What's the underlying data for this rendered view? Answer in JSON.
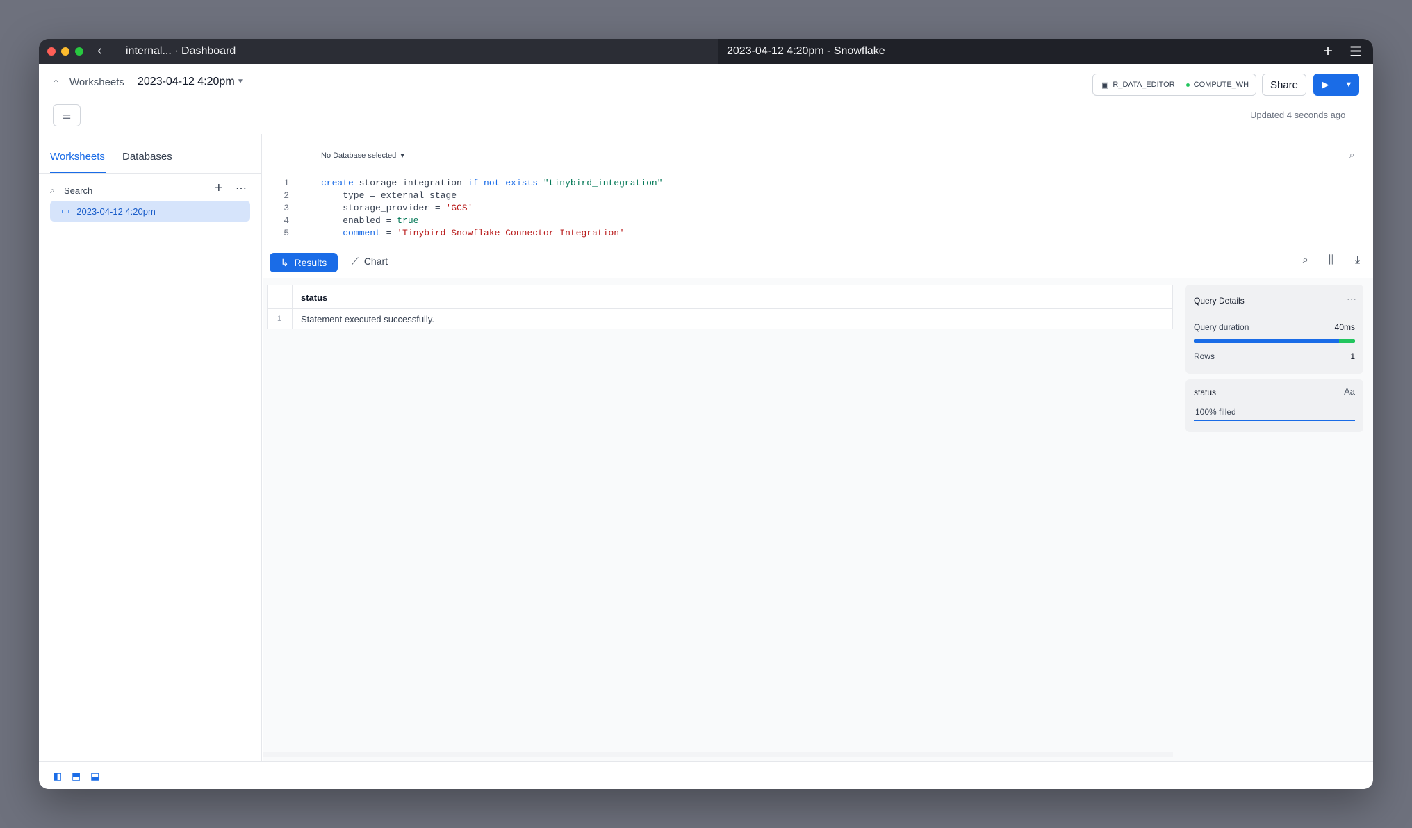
{
  "titlebar": {
    "left_title": "internal... · Dashboard",
    "right_title": "2023-04-12 4:20pm - Snowflake"
  },
  "header": {
    "breadcrumb": "Worksheets",
    "worksheet_title": "2023-04-12 4:20pm",
    "role": "R_DATA_EDITOR",
    "warehouse": "COMPUTE_WH",
    "share_label": "Share",
    "updated": "Updated 4 seconds ago"
  },
  "sidebar": {
    "tabs": [
      {
        "label": "Worksheets",
        "active": true
      },
      {
        "label": "Databases",
        "active": false
      }
    ],
    "search_placeholder": "Search",
    "items": [
      {
        "label": "2023-04-12 4:20pm",
        "selected": true
      }
    ]
  },
  "editor": {
    "database_selector": "No Database selected",
    "lines": [
      {
        "n": "1"
      },
      {
        "n": "2"
      },
      {
        "n": "3"
      },
      {
        "n": "4"
      },
      {
        "n": "5"
      }
    ]
  },
  "results": {
    "tabs": [
      {
        "label": "Results",
        "active": true
      },
      {
        "label": "Chart",
        "active": false
      }
    ],
    "columns": [
      "status"
    ],
    "rows": [
      {
        "n": "1",
        "status": "Statement executed successfully."
      }
    ]
  },
  "query_details": {
    "title": "Query Details",
    "duration_label": "Query duration",
    "duration_value": "40ms",
    "duration_bar_fraction": 0.9,
    "rows_label": "Rows",
    "rows_value": "1"
  },
  "column_stats": {
    "name": "status",
    "type_icon": "Aa",
    "filled_text": "100% filled",
    "filled_fraction": 1.0
  },
  "colors": {
    "accent": "#1a6ce7",
    "success": "#22c55e",
    "titlebar": "#1f2128"
  }
}
